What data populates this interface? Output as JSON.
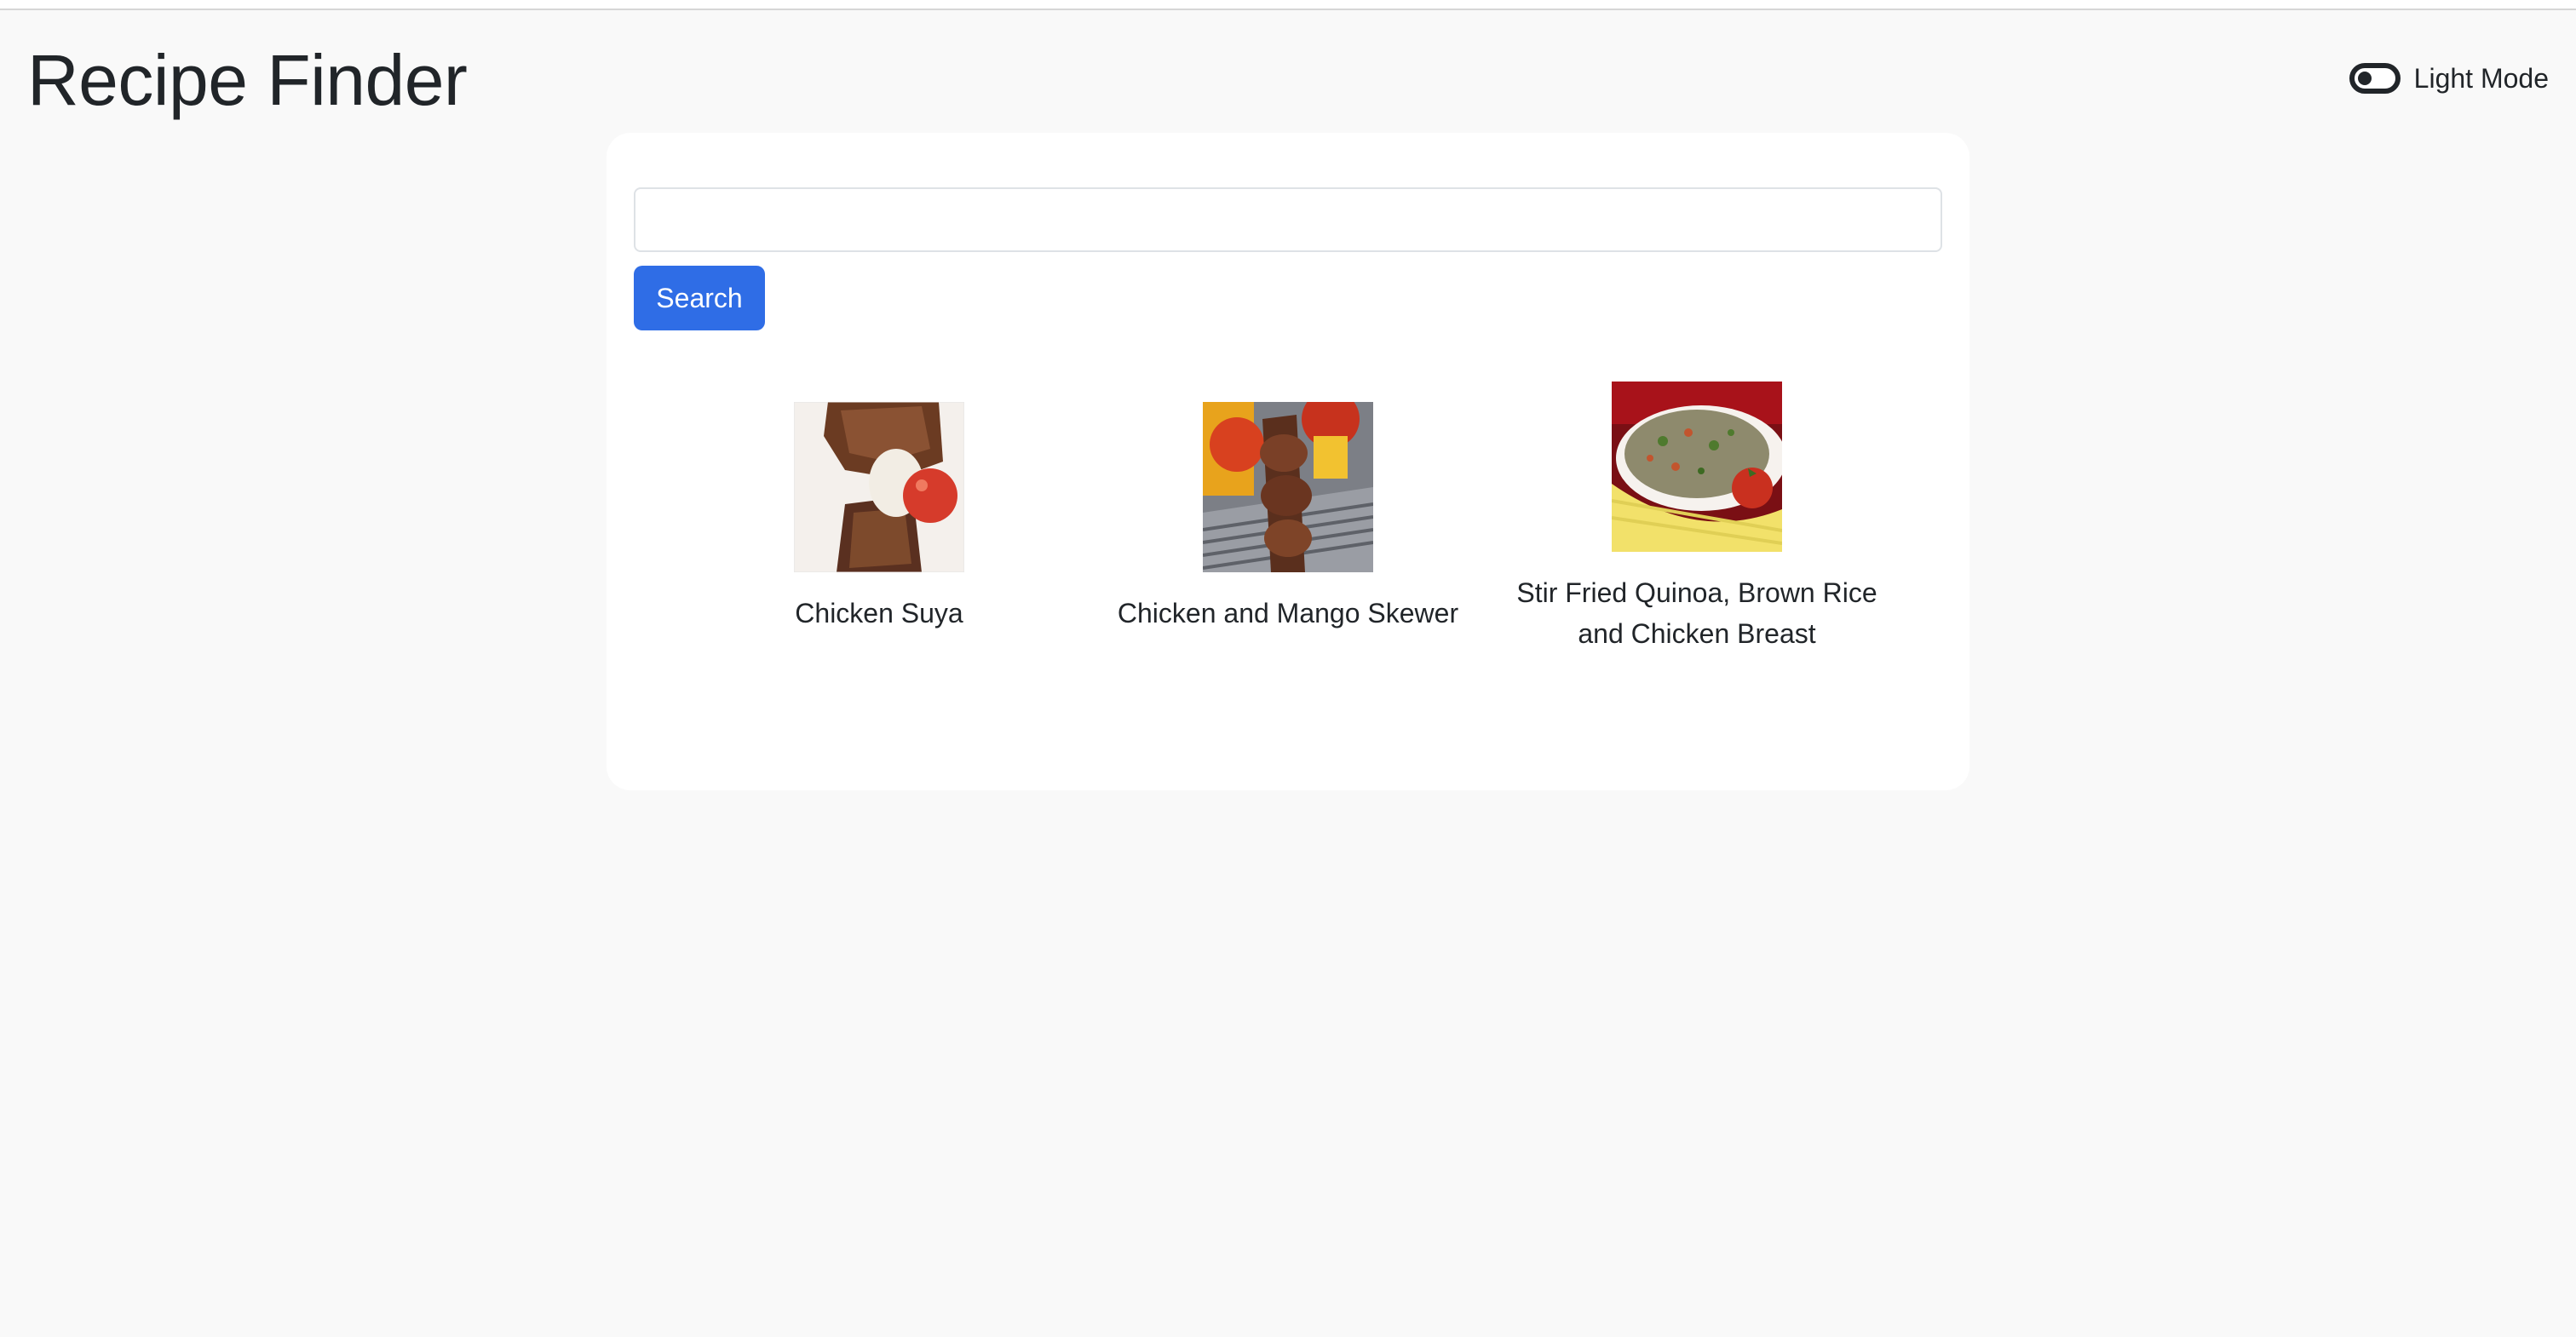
{
  "header": {
    "title": "Recipe Finder",
    "theme_label": "Light Mode"
  },
  "search": {
    "value": "",
    "placeholder": "",
    "button_label": "Search"
  },
  "results": [
    {
      "name": "Chicken Suya",
      "thumb": "grilled-chicken-thumbnail"
    },
    {
      "name": "Chicken and Mango Skewer",
      "thumb": "skewer-thumbnail"
    },
    {
      "name": "Stir Fried Quinoa, Brown Rice and Chicken Breast",
      "thumb": "quinoa-bowl-thumbnail"
    }
  ],
  "colors": {
    "accent": "#2f6de6",
    "background": "#f9f9f9",
    "card": "#ffffff",
    "text": "#212529"
  }
}
